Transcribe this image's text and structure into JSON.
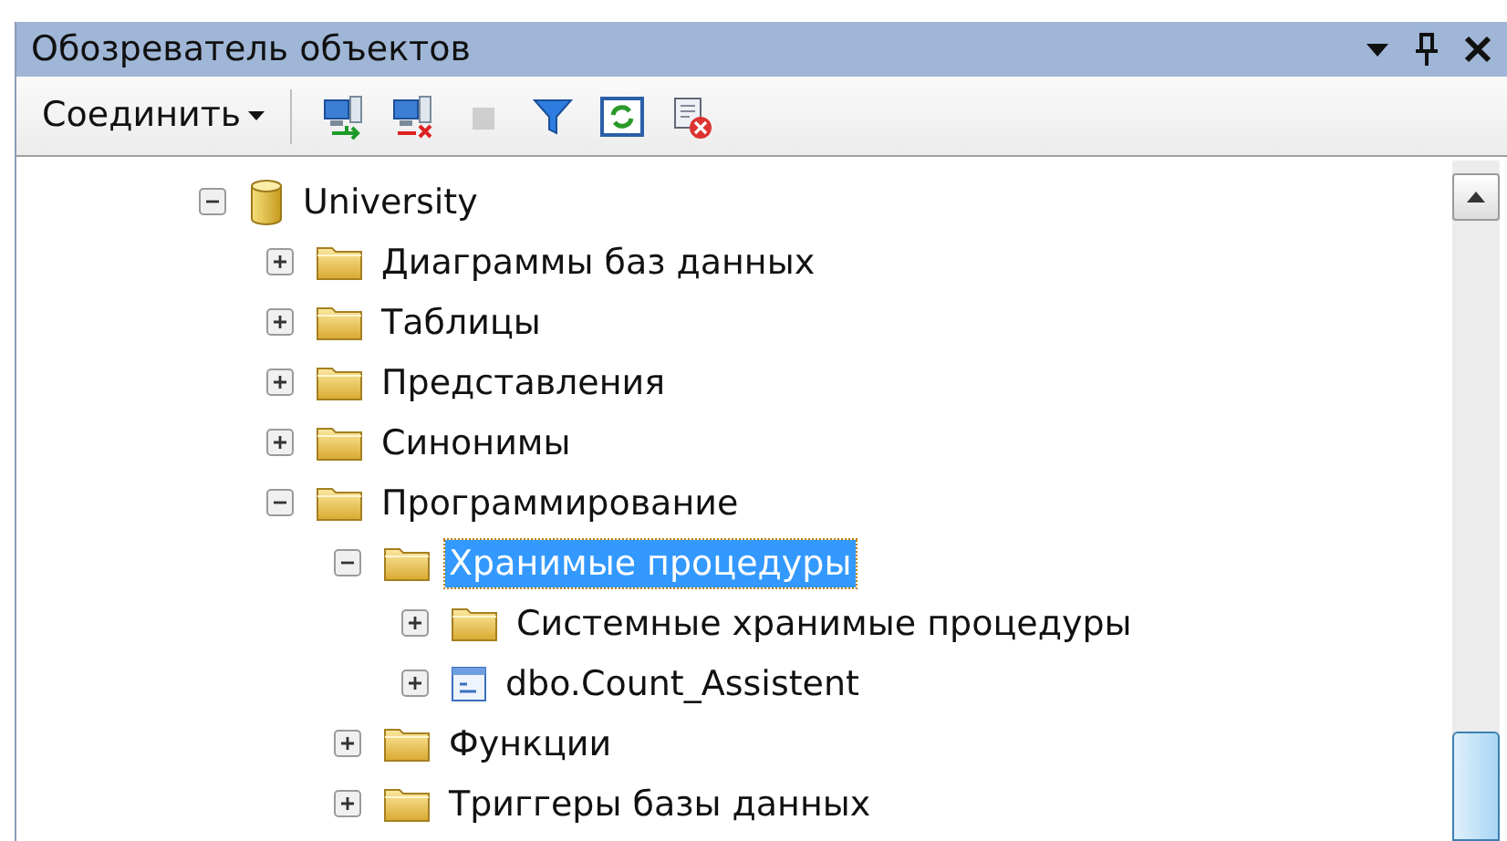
{
  "window": {
    "title": "Обозреватель объектов"
  },
  "toolbar": {
    "connect_label": "Соединить",
    "tools": [
      {
        "kind": "connect",
        "disabled": false
      },
      {
        "kind": "disconnect",
        "disabled": false
      },
      {
        "kind": "stop",
        "disabled": true
      },
      {
        "kind": "filter",
        "disabled": false
      },
      {
        "kind": "refresh",
        "disabled": false
      },
      {
        "kind": "stop-script",
        "disabled": false
      }
    ]
  },
  "tree": [
    {
      "label": "University",
      "kind": "database",
      "expanded": true,
      "selected": false,
      "children": [
        {
          "label": "Диаграммы баз данных",
          "kind": "folder",
          "expanded": false,
          "selected": false
        },
        {
          "label": "Таблицы",
          "kind": "folder",
          "expanded": false,
          "selected": false
        },
        {
          "label": "Представления",
          "kind": "folder",
          "expanded": false,
          "selected": false
        },
        {
          "label": "Синонимы",
          "kind": "folder",
          "expanded": false,
          "selected": false
        },
        {
          "label": "Программирование",
          "kind": "folder",
          "expanded": true,
          "selected": false,
          "children": [
            {
              "label": "Хранимые процедуры",
              "kind": "folder",
              "expanded": true,
              "selected": true,
              "children": [
                {
                  "label": "Системные хранимые процедуры",
                  "kind": "folder",
                  "expanded": false,
                  "selected": false
                },
                {
                  "label": "dbo.Count_Assistent",
                  "kind": "procedure",
                  "expanded": false,
                  "selected": false
                }
              ]
            },
            {
              "label": "Функции",
              "kind": "folder",
              "expanded": false,
              "selected": false
            },
            {
              "label": "Триггеры базы данных",
              "kind": "folder",
              "expanded": false,
              "selected": false
            }
          ]
        }
      ]
    }
  ]
}
